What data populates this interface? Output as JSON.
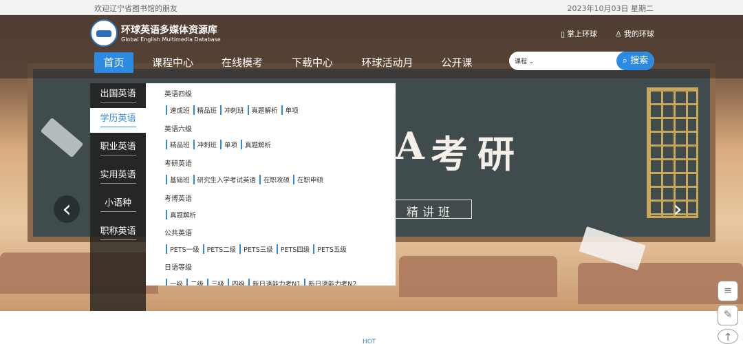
{
  "topbar": {
    "welcome": "欢迎辽宁省图书馆的朋友",
    "date": "2023年10月03日 星期二"
  },
  "brand": {
    "name": "环球英语多媒体资源库",
    "english": "Global English Multimedia Database"
  },
  "header_links": {
    "mobile": "掌上环球",
    "mine": "我的环球"
  },
  "nav": [
    "首页",
    "课程中心",
    "在线模考",
    "下载中心",
    "环球活动月",
    "公开课"
  ],
  "search": {
    "select": "课程",
    "button": "搜索",
    "placeholder": ""
  },
  "side_menu": [
    "出国英语",
    "学历英语",
    "职业英语",
    "实用英语",
    "小语种",
    "职称英语"
  ],
  "dropdown": [
    {
      "title": "英语四级",
      "links": [
        "速成班",
        "精品班",
        "冲刺班",
        "真题解析",
        "单项"
      ]
    },
    {
      "title": "英语六级",
      "links": [
        "精品班",
        "冲刺班",
        "单项",
        "真题解析"
      ]
    },
    {
      "title": "考研英语",
      "links": [
        "基础班",
        "研究生入学考试英语",
        "在职攻硕",
        "在职申硕"
      ]
    },
    {
      "title": "考博英语",
      "links": [
        "真题解析"
      ]
    },
    {
      "title": "公共英语",
      "links": [
        "PETS一级",
        "PETS二级",
        "PETS三级",
        "PETS四级",
        "PETS五级"
      ]
    },
    {
      "title": "日语等级",
      "links": [
        "一级",
        "二级",
        "三级",
        "四级",
        "新日语能力考N1",
        "新日语能力考N2"
      ]
    }
  ],
  "banner": {
    "title": "考研",
    "title_partial": "A",
    "subtitle": "精讲班"
  },
  "hot_label": "HOT",
  "colors": {
    "accent": "#2c8be0"
  }
}
